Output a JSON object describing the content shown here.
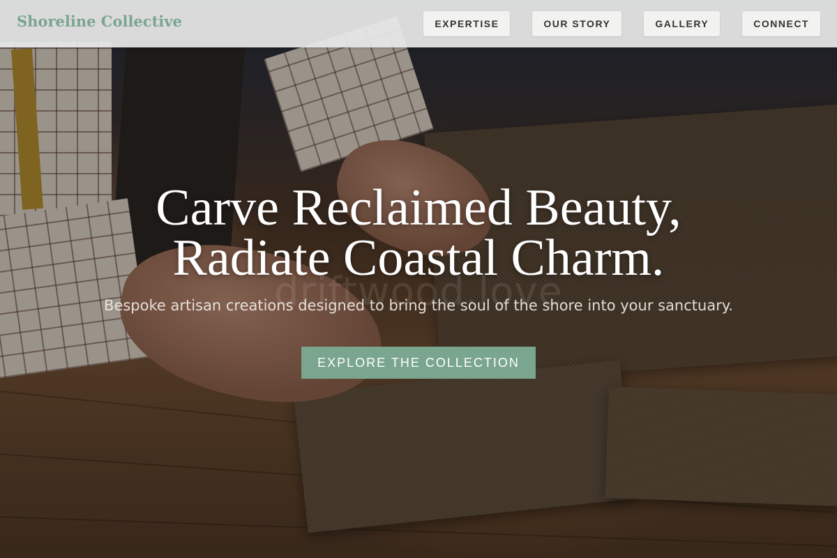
{
  "brand": {
    "name": "Shoreline Collective",
    "color": "#7aa58f"
  },
  "nav": {
    "items": [
      {
        "label": "EXPERTISE"
      },
      {
        "label": "OUR STORY"
      },
      {
        "label": "GALLERY"
      },
      {
        "label": "CONNECT"
      }
    ]
  },
  "hero": {
    "headline_line1": "Carve Reclaimed Beauty,",
    "headline_line2": "Radiate Coastal Charm.",
    "watermark": "driftwood.love",
    "subheadline": "Bespoke artisan creations designed to bring the soul of the shore into your sanctuary.",
    "cta_label": "EXPLORE THE COLLECTION",
    "accent_color": "#7aa58f"
  }
}
